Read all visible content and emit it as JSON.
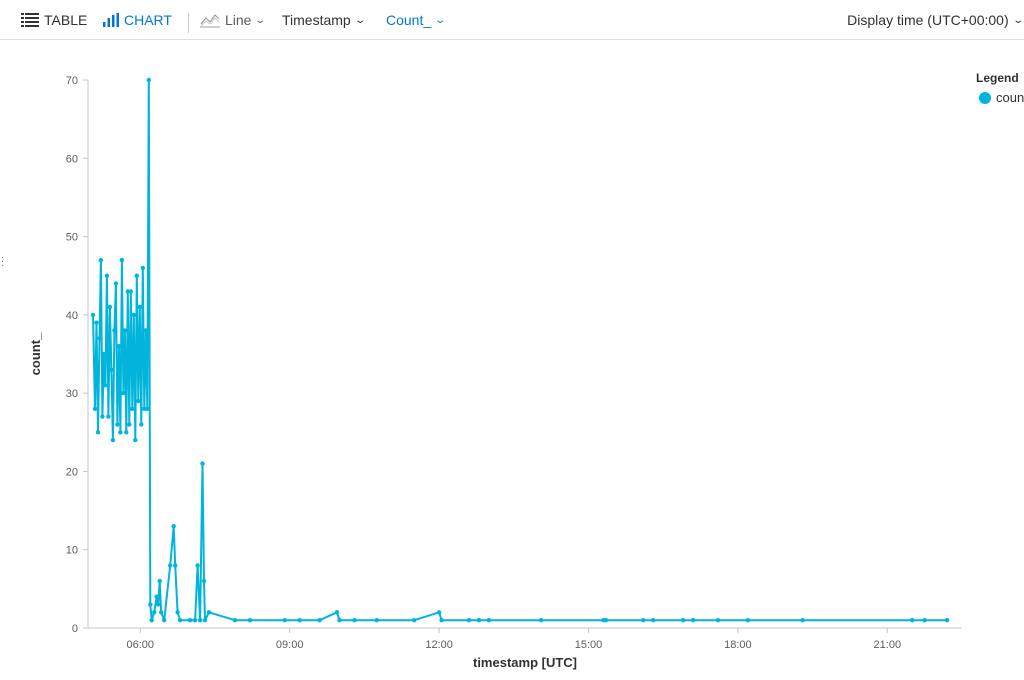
{
  "toolbar": {
    "table_label": "TABLE",
    "chart_label": "CHART",
    "chart_type_label": "Line",
    "x_column_label": "Timestamp",
    "y_column_label": "Count_",
    "display_time_label": "Display time (UTC+00:00)"
  },
  "legend": {
    "title": "Legend",
    "items": [
      {
        "label": "count_",
        "color": "#00b4dc"
      }
    ]
  },
  "colors": {
    "accent": "#0078d4",
    "series": "#00b4dc"
  },
  "icons": [
    "table-icon",
    "bar-chart-icon",
    "line-chart-icon",
    "chevron-down-icon"
  ],
  "chart_data": {
    "type": "line",
    "title": "",
    "xlabel": "timestamp [UTC]",
    "ylabel": "count_",
    "x_unit": "hours (UTC time of day)",
    "xlim": [
      4.95,
      22.5
    ],
    "ylim": [
      0,
      70
    ],
    "yticks": [
      0,
      10,
      20,
      30,
      40,
      50,
      60,
      70
    ],
    "xticks": [
      {
        "value": 6,
        "label": "06:00"
      },
      {
        "value": 9,
        "label": "09:00"
      },
      {
        "value": 12,
        "label": "12:00"
      },
      {
        "value": 15,
        "label": "15:00"
      },
      {
        "value": 18,
        "label": "18:00"
      },
      {
        "value": 21,
        "label": "21:00"
      }
    ],
    "grid": false,
    "legend_position": "top-right",
    "series": [
      {
        "name": "count_",
        "points": [
          [
            5.05,
            40
          ],
          [
            5.09,
            28
          ],
          [
            5.12,
            39
          ],
          [
            5.15,
            25
          ],
          [
            5.18,
            37
          ],
          [
            5.21,
            47
          ],
          [
            5.24,
            27
          ],
          [
            5.27,
            35
          ],
          [
            5.3,
            31
          ],
          [
            5.33,
            45
          ],
          [
            5.36,
            27
          ],
          [
            5.39,
            41
          ],
          [
            5.42,
            33
          ],
          [
            5.45,
            24
          ],
          [
            5.48,
            38
          ],
          [
            5.51,
            44
          ],
          [
            5.54,
            26
          ],
          [
            5.57,
            36
          ],
          [
            5.6,
            25
          ],
          [
            5.63,
            47
          ],
          [
            5.66,
            30
          ],
          [
            5.69,
            38
          ],
          [
            5.72,
            25
          ],
          [
            5.75,
            43
          ],
          [
            5.78,
            26
          ],
          [
            5.81,
            43
          ],
          [
            5.84,
            28
          ],
          [
            5.87,
            40
          ],
          [
            5.9,
            24
          ],
          [
            5.93,
            45
          ],
          [
            5.96,
            29
          ],
          [
            5.99,
            41
          ],
          [
            6.02,
            26
          ],
          [
            6.05,
            46
          ],
          [
            6.08,
            28
          ],
          [
            6.11,
            38
          ],
          [
            6.14,
            28
          ],
          [
            6.17,
            70
          ],
          [
            6.2,
            3
          ],
          [
            6.23,
            1
          ],
          [
            6.28,
            2
          ],
          [
            6.33,
            4
          ],
          [
            6.36,
            3
          ],
          [
            6.39,
            6
          ],
          [
            6.42,
            2
          ],
          [
            6.48,
            1
          ],
          [
            6.6,
            8
          ],
          [
            6.67,
            13
          ],
          [
            6.7,
            8
          ],
          [
            6.75,
            2
          ],
          [
            6.8,
            1
          ],
          [
            7.0,
            1
          ],
          [
            7.1,
            1
          ],
          [
            7.15,
            8
          ],
          [
            7.2,
            1
          ],
          [
            7.25,
            21
          ],
          [
            7.28,
            6
          ],
          [
            7.3,
            1
          ],
          [
            7.38,
            2
          ],
          [
            7.9,
            1
          ],
          [
            8.2,
            1
          ],
          [
            8.9,
            1
          ],
          [
            9.2,
            1
          ],
          [
            9.6,
            1
          ],
          [
            9.95,
            2
          ],
          [
            10.0,
            1
          ],
          [
            10.3,
            1
          ],
          [
            10.75,
            1
          ],
          [
            11.5,
            1
          ],
          [
            12.0,
            2
          ],
          [
            12.05,
            1
          ],
          [
            12.6,
            1
          ],
          [
            12.8,
            1
          ],
          [
            13.0,
            1
          ],
          [
            14.05,
            1
          ],
          [
            15.3,
            1
          ],
          [
            15.35,
            1
          ],
          [
            16.1,
            1
          ],
          [
            16.3,
            1
          ],
          [
            16.9,
            1
          ],
          [
            17.1,
            1
          ],
          [
            17.6,
            1
          ],
          [
            18.2,
            1
          ],
          [
            19.3,
            1
          ],
          [
            21.5,
            1
          ],
          [
            21.75,
            1
          ],
          [
            22.2,
            1
          ]
        ]
      }
    ]
  }
}
